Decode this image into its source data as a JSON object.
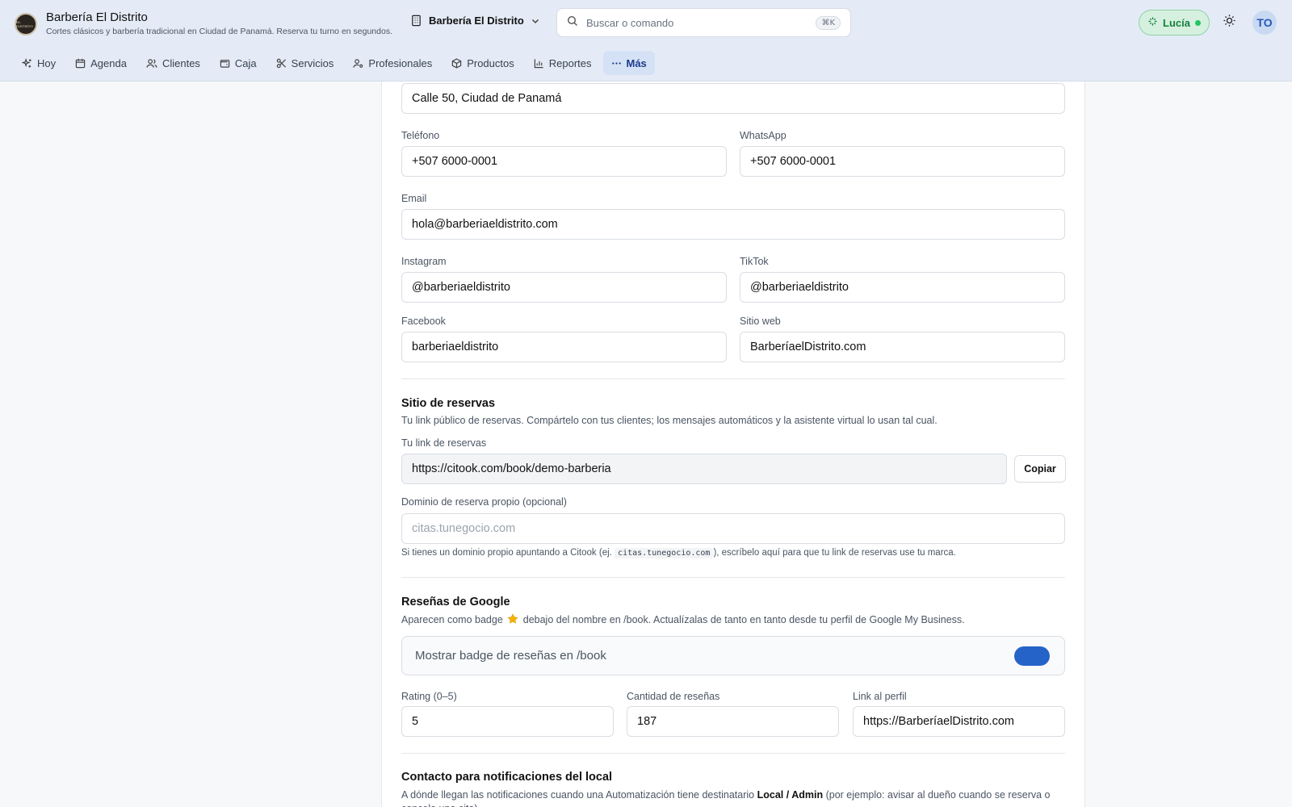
{
  "header": {
    "logo_text": "EL DISTRITO",
    "title": "Barbería El Distrito",
    "subtitle": "Cortes clásicos y barbería tradicional en Ciudad de Panamá. Reserva tu turno en segundos.",
    "business_selector": "Barbería El Distrito",
    "search_placeholder": "Buscar o comando",
    "search_shortcut": "⌘K",
    "assistant_label": "Lucía",
    "avatar_initials": "TO"
  },
  "nav": {
    "items": [
      {
        "label": "Hoy",
        "icon": "sparkle-icon"
      },
      {
        "label": "Agenda",
        "icon": "calendar-icon"
      },
      {
        "label": "Clientes",
        "icon": "users-icon"
      },
      {
        "label": "Caja",
        "icon": "wallet-icon"
      },
      {
        "label": "Servicios",
        "icon": "scissors-icon"
      },
      {
        "label": "Profesionales",
        "icon": "user-gear-icon"
      },
      {
        "label": "Productos",
        "icon": "box-icon"
      },
      {
        "label": "Reportes",
        "icon": "bar-chart-icon"
      },
      {
        "label": "Más",
        "icon": "dots-icon",
        "active": true
      }
    ]
  },
  "form": {
    "address_value": "Calle 50, Ciudad de Panamá",
    "phone_label": "Teléfono",
    "phone_value": "+507 6000-0001",
    "whatsapp_label": "WhatsApp",
    "whatsapp_value": "+507 6000-0001",
    "email_label": "Email",
    "email_value": "hola@barberiaeldistrito.com",
    "instagram_label": "Instagram",
    "instagram_value": "@barberiaeldistrito",
    "tiktok_label": "TikTok",
    "tiktok_value": "@barberiaeldistrito",
    "facebook_label": "Facebook",
    "facebook_value": "barberiaeldistrito",
    "website_label": "Sitio web",
    "website_value": "BarberíaelDistrito.com"
  },
  "booking": {
    "title": "Sitio de reservas",
    "description": "Tu link público de reservas. Compártelo con tus clientes; los mensajes automáticos y la asistente virtual lo usan tal cual.",
    "link_label": "Tu link de reservas",
    "link_value": "https://citook.com/book/demo-barberia",
    "copy_button": "Copiar",
    "domain_label": "Dominio de reserva propio (opcional)",
    "domain_placeholder": "citas.tunegocio.com",
    "hint_before": "Si tienes un dominio propio apuntando a Citook (ej.",
    "hint_code": "citas.tunegocio.com",
    "hint_after": "), escríbelo aquí para que tu link de reservas use tu marca."
  },
  "reviews": {
    "title": "Reseñas de Google",
    "description_before": "Aparecen como badge",
    "description_after": "debajo del nombre en /book. Actualízalas de tanto en tanto desde tu perfil de Google My Business.",
    "toggle_label": "Mostrar badge de reseñas en /book",
    "toggle_on": true,
    "rating_label": "Rating (0–5)",
    "rating_value": "5",
    "count_label": "Cantidad de reseñas",
    "count_value": "187",
    "profile_label": "Link al perfil",
    "profile_value": "https://BarberíaelDistrito.com"
  },
  "notifications": {
    "title": "Contacto para notificaciones del local",
    "desc_before": "A dónde llegan las notificaciones cuando una Automatización tiene destinatario",
    "desc_bold": "Local / Admin",
    "desc_after": "(por ejemplo: avisar al dueño cuando se reserva o cancela una cita)."
  },
  "colors": {
    "accent": "#2563c9",
    "header_bg": "#e4ebf6",
    "assistant_green": "#15803d"
  }
}
